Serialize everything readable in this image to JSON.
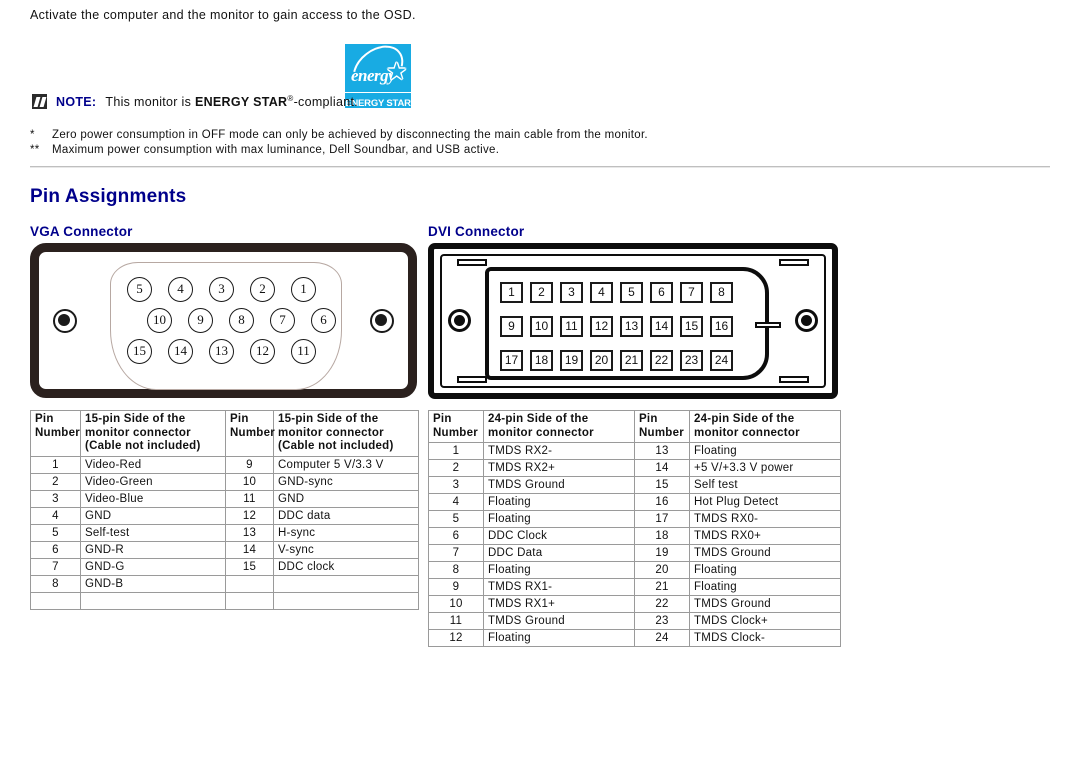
{
  "intro": {
    "line": "Activate the computer and the monitor to gain access to the OSD."
  },
  "energy_star": {
    "word": "energy",
    "star_glyph": "★",
    "banner": "ENERGY STAR",
    "color": "#18ABE3"
  },
  "note": {
    "icon": "note-pencil-icon",
    "label": "NOTE:",
    "text_before": "This monitor is ",
    "brand": "ENERGY STAR",
    "registered": "®",
    "text_after": "-compliant.",
    "label_color": "#00008B"
  },
  "footnotes": [
    {
      "mark": "*",
      "text": "Zero power consumption in OFF mode can only be achieved by disconnecting the main cable from the monitor."
    },
    {
      "mark": "**",
      "text": "Maximum power consumption with max luminance, Dell Soundbar, and USB active."
    }
  ],
  "page_title": "Pin Assignments",
  "heading_color": "#00008B",
  "vga": {
    "title": "VGA Connector",
    "connector": {
      "type": "db15-vga",
      "rows": [
        [
          "5",
          "4",
          "3",
          "2",
          "1"
        ],
        [
          "10",
          "9",
          "8",
          "7",
          "6"
        ],
        [
          "15",
          "14",
          "13",
          "12",
          "11"
        ]
      ]
    },
    "table": {
      "headers": [
        "Pin Number",
        "15-pin Side of the monitor connector (Cable not included)",
        "Pin Number",
        "15-pin Side of the monitor connector (Cable not included)"
      ],
      "header_lines": {
        "col1": [
          "Pin",
          "Number"
        ],
        "col2": [
          "15-pin Side of the",
          "monitor connector",
          "(Cable not included)"
        ],
        "col3": [
          "Pin",
          "Number"
        ],
        "col4": [
          "15-pin Side of the",
          "monitor connector",
          "(Cable not included)"
        ]
      },
      "rows": [
        {
          "pin_a": "1",
          "sig_a": "Video-Red",
          "pin_b": "9",
          "sig_b": "Computer 5 V/3.3 V"
        },
        {
          "pin_a": "2",
          "sig_a": "Video-Green",
          "pin_b": "10",
          "sig_b": "GND-sync"
        },
        {
          "pin_a": "3",
          "sig_a": "Video-Blue",
          "pin_b": "11",
          "sig_b": "GND"
        },
        {
          "pin_a": "4",
          "sig_a": "GND",
          "pin_b": "12",
          "sig_b": "DDC data"
        },
        {
          "pin_a": "5",
          "sig_a": "Self-test",
          "pin_b": "13",
          "sig_b": "H-sync"
        },
        {
          "pin_a": "6",
          "sig_a": "GND-R",
          "pin_b": "14",
          "sig_b": "V-sync"
        },
        {
          "pin_a": "7",
          "sig_a": "GND-G",
          "pin_b": "15",
          "sig_b": "DDC clock"
        },
        {
          "pin_a": "8",
          "sig_a": "GND-B",
          "pin_b": "",
          "sig_b": ""
        },
        {
          "pin_a": "",
          "sig_a": "",
          "pin_b": "",
          "sig_b": ""
        }
      ]
    }
  },
  "dvi": {
    "title": "DVI Connector",
    "connector": {
      "type": "dvi-d-24pin",
      "rows": [
        [
          "1",
          "2",
          "3",
          "4",
          "5",
          "6",
          "7",
          "8"
        ],
        [
          "9",
          "10",
          "11",
          "12",
          "13",
          "14",
          "15",
          "16"
        ],
        [
          "17",
          "18",
          "19",
          "20",
          "21",
          "22",
          "23",
          "24"
        ]
      ]
    },
    "table": {
      "headers": [
        "Pin Number",
        "24-pin Side of the monitor connector",
        "Pin Number",
        "24-pin Side of the monitor connector"
      ],
      "header_lines": {
        "col1": [
          "Pin",
          "Number"
        ],
        "col2": [
          "24-pin Side of the",
          "monitor connector"
        ],
        "col3": [
          "Pin",
          "Number"
        ],
        "col4": [
          "24-pin Side of the",
          "monitor connector"
        ]
      },
      "rows": [
        {
          "pin_a": "1",
          "sig_a": "TMDS RX2-",
          "pin_b": "13",
          "sig_b": "Floating"
        },
        {
          "pin_a": "2",
          "sig_a": "TMDS RX2+",
          "pin_b": "14",
          "sig_b": "+5 V/+3.3 V power"
        },
        {
          "pin_a": "3",
          "sig_a": "TMDS Ground",
          "pin_b": "15",
          "sig_b": "Self test"
        },
        {
          "pin_a": "4",
          "sig_a": "Floating",
          "pin_b": "16",
          "sig_b": "Hot Plug Detect"
        },
        {
          "pin_a": "5",
          "sig_a": "Floating",
          "pin_b": "17",
          "sig_b": "TMDS RX0-"
        },
        {
          "pin_a": "6",
          "sig_a": "DDC Clock",
          "pin_b": "18",
          "sig_b": "TMDS RX0+"
        },
        {
          "pin_a": "7",
          "sig_a": "DDC Data",
          "pin_b": "19",
          "sig_b": "TMDS Ground"
        },
        {
          "pin_a": "8",
          "sig_a": "Floating",
          "pin_b": "20",
          "sig_b": "Floating"
        },
        {
          "pin_a": "9",
          "sig_a": "TMDS RX1-",
          "pin_b": "21",
          "sig_b": "Floating"
        },
        {
          "pin_a": "10",
          "sig_a": "TMDS RX1+",
          "pin_b": "22",
          "sig_b": "TMDS Ground"
        },
        {
          "pin_a": "11",
          "sig_a": "TMDS Ground",
          "pin_b": "23",
          "sig_b": "TMDS Clock+"
        },
        {
          "pin_a": "12",
          "sig_a": "Floating",
          "pin_b": "24",
          "sig_b": "TMDS Clock-"
        }
      ]
    }
  }
}
